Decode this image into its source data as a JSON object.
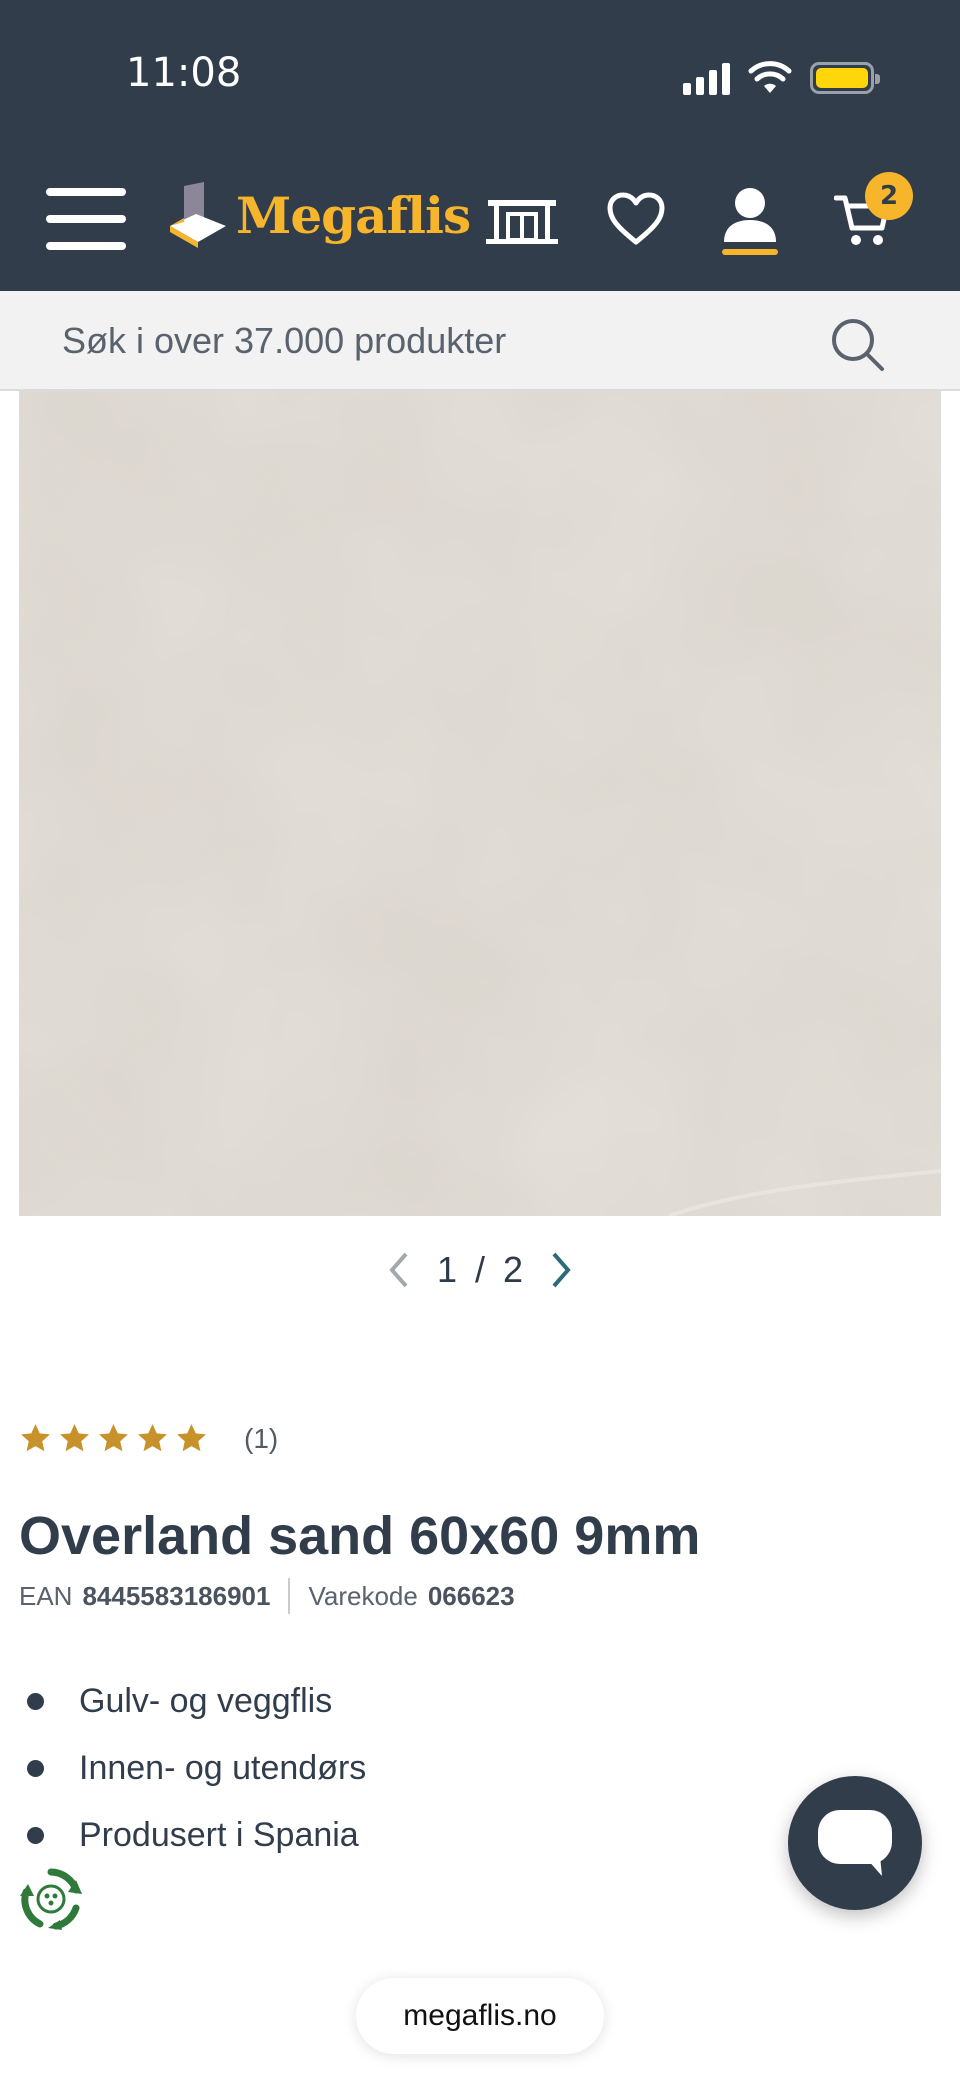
{
  "status_bar": {
    "time": "11:08"
  },
  "header": {
    "logo_text": "Megaflis",
    "cart_count": "2",
    "icons": [
      "menu-icon",
      "showroom-icon",
      "heart-icon",
      "user-icon",
      "cart-icon"
    ]
  },
  "search": {
    "placeholder": "Søk i over 37.000 produkter"
  },
  "gallery": {
    "current": "1",
    "separator": "/",
    "total": "2"
  },
  "product": {
    "rating_stars": 5,
    "rating_count": "(1)",
    "title": "Overland sand 60x60 9mm",
    "ean_label": "EAN",
    "ean_value": "8445583186901",
    "sku_label": "Varekode",
    "sku_value": "066623",
    "features": [
      "Gulv- og veggflis",
      "Innen- og utendørs",
      "Produsert i Spania"
    ]
  },
  "browser": {
    "url": "megaflis.no"
  },
  "colors": {
    "header_bg": "#323d4c",
    "accent": "#f7b52c",
    "star": "#c8922a",
    "pager_arrow": "#2d6b78"
  }
}
